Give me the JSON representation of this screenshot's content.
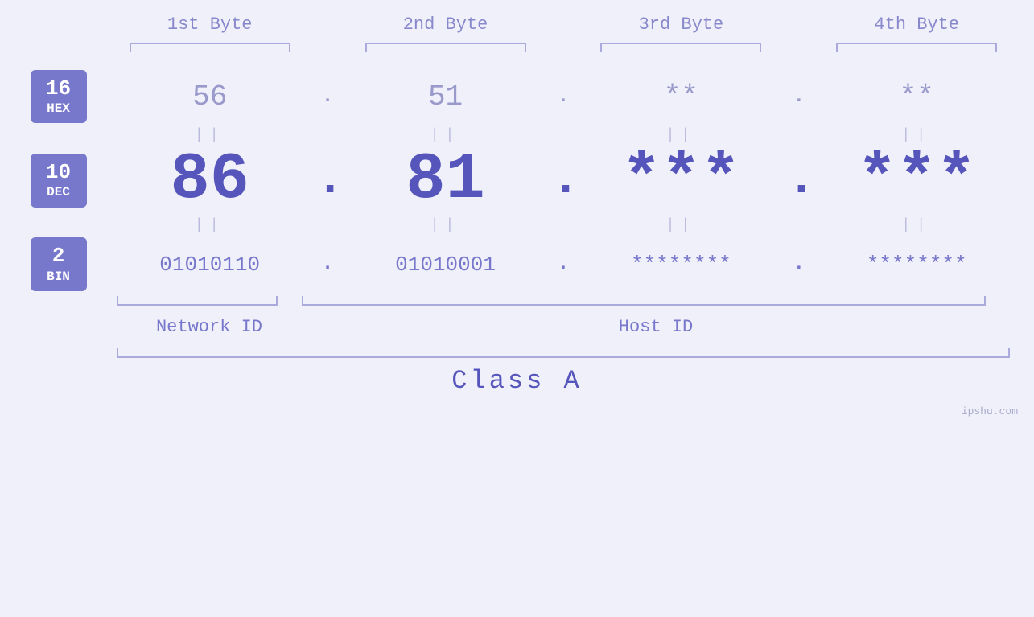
{
  "header": {
    "byte1": "1st Byte",
    "byte2": "2nd Byte",
    "byte3": "3rd Byte",
    "byte4": "4th Byte"
  },
  "labels": {
    "hex": {
      "num": "16",
      "name": "HEX"
    },
    "dec": {
      "num": "10",
      "name": "DEC"
    },
    "bin": {
      "num": "2",
      "name": "BIN"
    }
  },
  "hex_row": {
    "val1": "56",
    "val2": "51",
    "val3": "**",
    "val4": "**",
    "dot": "."
  },
  "dec_row": {
    "val1": "86",
    "val2": "81",
    "val3": "***",
    "val4": "***",
    "dot": "."
  },
  "bin_row": {
    "val1": "01010110",
    "val2": "01010001",
    "val3": "********",
    "val4": "********",
    "dot": "."
  },
  "equals": {
    "symbol": "||"
  },
  "bottom": {
    "network_id": "Network ID",
    "host_id": "Host ID",
    "class": "Class A",
    "watermark": "ipshu.com"
  }
}
